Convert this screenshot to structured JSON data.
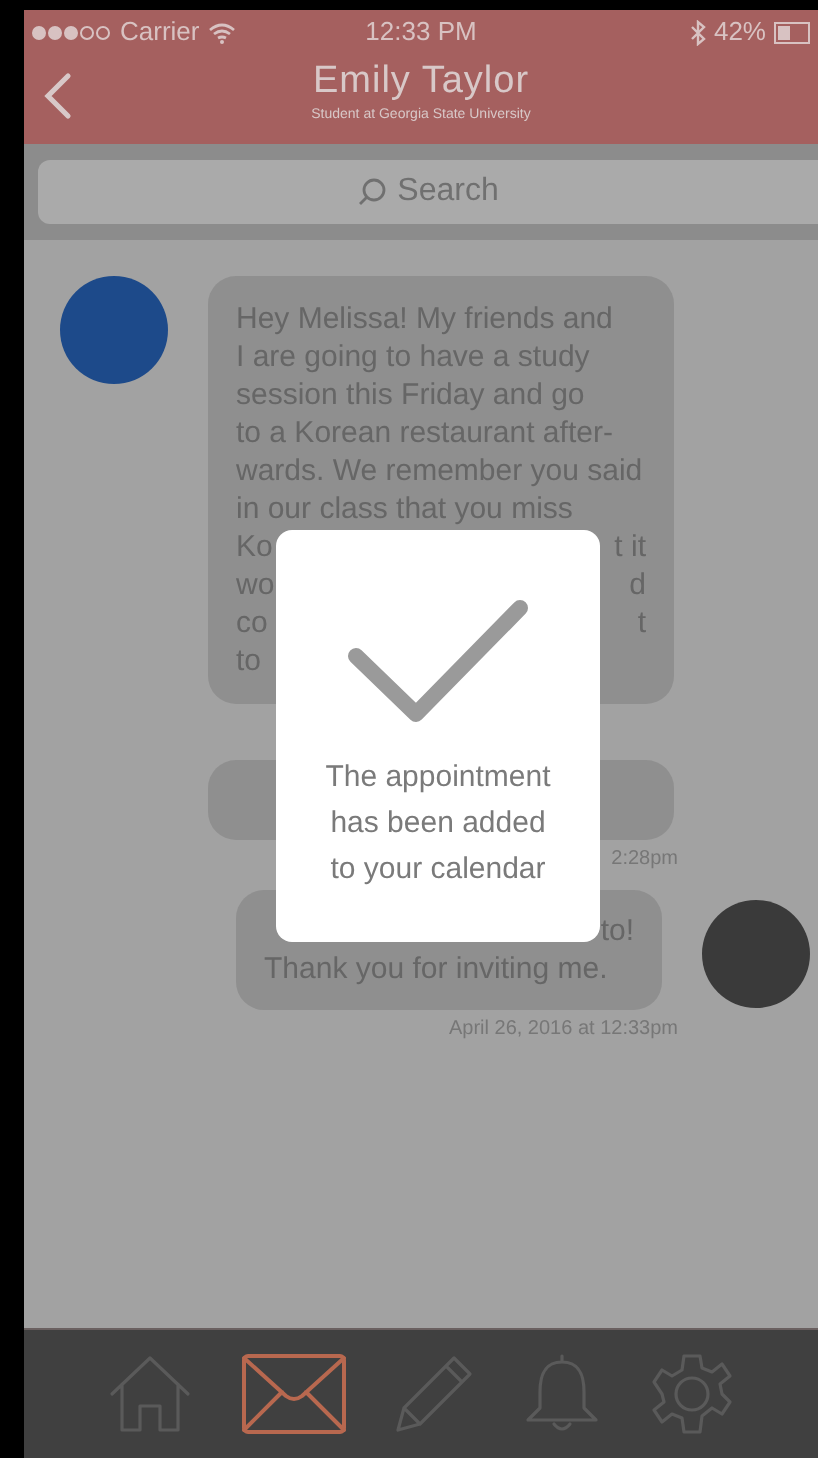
{
  "status_bar": {
    "carrier": "Carrier",
    "time": "12:33 PM",
    "battery": "42%"
  },
  "header": {
    "title": "Emily Taylor",
    "subtitle": "Student at Georgia State University"
  },
  "search": {
    "placeholder": "Search"
  },
  "messages": [
    {
      "kind": "incoming",
      "avatar": true,
      "lines": [
        {
          "text": "Hey Melissa! My friends and"
        },
        {
          "text": "I are going to have a study"
        },
        {
          "text": "session this Friday and go"
        },
        {
          "text": "to a Korean restaurant after-"
        },
        {
          "text": "wards. We remember you said"
        },
        {
          "text": "in our class that you miss"
        },
        {
          "left": "Ko",
          "right": "t it"
        },
        {
          "left": "wo",
          "right": "d"
        },
        {
          "left": "co",
          "right": "t"
        },
        {
          "left": "to"
        }
      ]
    },
    {
      "kind": "incoming",
      "avatar": false,
      "timestamp": "2:28pm"
    },
    {
      "kind": "outgoing",
      "avatar": true,
      "lines": [
        {
          "right": "to!"
        },
        {
          "text": "Thank you for inviting me."
        }
      ],
      "timestamp": "April 26, 2016 at 12:33pm"
    }
  ],
  "dialog": {
    "message": "The appointment has been added to your calendar"
  },
  "nav": [
    {
      "kind": "home",
      "selected": false
    },
    {
      "kind": "mail",
      "selected": true
    },
    {
      "kind": "pencil",
      "selected": false
    },
    {
      "kind": "bell",
      "selected": false
    },
    {
      "kind": "settings",
      "selected": false
    }
  ]
}
